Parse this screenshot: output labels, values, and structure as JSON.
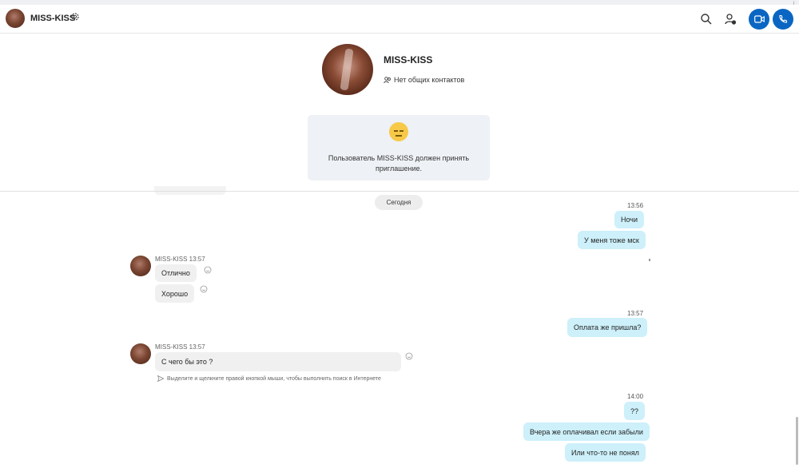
{
  "window": {
    "corner_glyph": "ᵢ"
  },
  "header": {
    "contact_name": "MISS-KISS",
    "icons": [
      "gear-icon",
      "search-icon",
      "add-contact-icon",
      "video-call-icon",
      "phone-call-icon"
    ],
    "accent_color": "#0a66c2"
  },
  "profile": {
    "name": "MISS-KISS",
    "contacts_note": "Нет общих контактов",
    "invite_message": "Пользователь MISS-KISS должен принять приглашение."
  },
  "chat": {
    "date_separator": "Сегодня",
    "outgoing_group_1": {
      "time": "13:56",
      "messages": [
        "Ночи",
        "У меня тоже мск"
      ]
    },
    "incoming_group_1": {
      "sender": "MISS-KISS 13:57",
      "messages": [
        "Отлично",
        "Хорошо"
      ]
    },
    "outgoing_group_2": {
      "time": "13:57",
      "messages": [
        "Оплата же пришла?"
      ]
    },
    "incoming_group_2": {
      "sender": "MISS-KISS 13:57",
      "messages": [
        "С чего бы это ?"
      ],
      "hint": "Выделите и щелкните правой кнопкой мыши, чтобы выполнить поиск в Интернете"
    },
    "outgoing_group_3": {
      "time": "14:00",
      "messages": [
        "??",
        "Вчера же оплачивал если забыли",
        "Или что-то не понял"
      ]
    },
    "colors": {
      "outgoing_bubble": "#cdf0fa",
      "incoming_bubble": "#f0f0f0"
    }
  }
}
